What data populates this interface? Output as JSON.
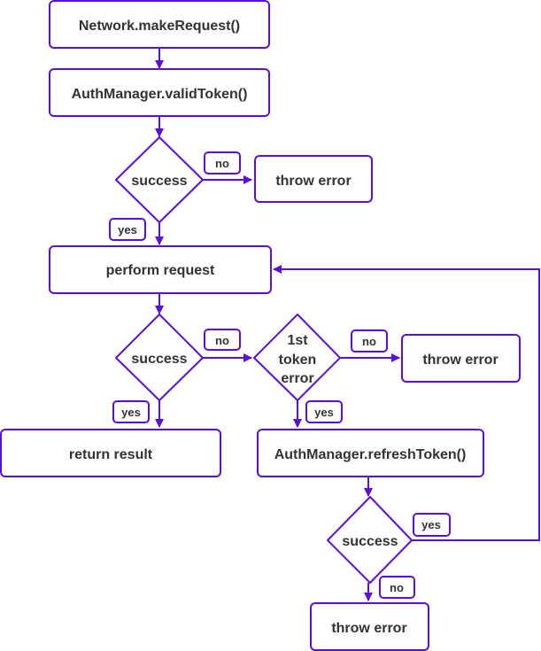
{
  "colors": {
    "stroke": "#5c0fd9",
    "text": "#333333",
    "background": "#ffffff"
  },
  "nodes": {
    "make_request": {
      "label": "Network.makeRequest()",
      "shape": "process"
    },
    "valid_token": {
      "label": "AuthManager.validToken()",
      "shape": "process"
    },
    "decision_valid": {
      "label": "success",
      "shape": "decision"
    },
    "throw_error_1": {
      "label": "throw error",
      "shape": "process"
    },
    "perform_request": {
      "label": "perform request",
      "shape": "process"
    },
    "decision_request": {
      "label": "success",
      "shape": "decision"
    },
    "decision_first_token": {
      "lines": [
        "1st",
        "token",
        "error"
      ],
      "shape": "decision"
    },
    "throw_error_2": {
      "label": "throw error",
      "shape": "process"
    },
    "return_result": {
      "label": "return result",
      "shape": "process"
    },
    "refresh_token": {
      "label": "AuthManager.refreshToken()",
      "shape": "process"
    },
    "decision_refresh": {
      "label": "success",
      "shape": "decision"
    },
    "throw_error_3": {
      "label": "throw error",
      "shape": "process"
    }
  },
  "edge_labels": {
    "valid_no": "no",
    "valid_yes": "yes",
    "request_no": "no",
    "request_yes": "yes",
    "first_token_no": "no",
    "first_token_yes": "yes",
    "refresh_yes": "yes",
    "refresh_no": "no"
  }
}
